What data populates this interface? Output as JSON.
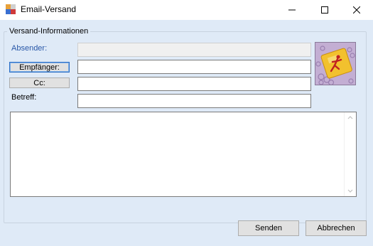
{
  "window": {
    "title": "Email-Versand",
    "icons": {
      "app": "app-icon",
      "minimize": "minimize-icon",
      "maximize": "maximize-icon",
      "close": "close-icon"
    }
  },
  "group": {
    "title": "Versand-Informationen"
  },
  "form": {
    "absender_label": "Absender:",
    "empfaenger_button": "Empfänger:",
    "cc_button": "Cc:",
    "betreff_label": "Betreff:",
    "absender_value": "",
    "empfaenger_value": "",
    "cc_value": "",
    "betreff_value": "",
    "body_value": ""
  },
  "actions": {
    "send": "Senden",
    "cancel": "Abbrechen"
  },
  "colors": {
    "client_bg": "#dfeaf7",
    "label_blue": "#2857a8",
    "focus_border": "#2e6fc4"
  },
  "logo": {
    "icon": "email-logo-icon"
  }
}
